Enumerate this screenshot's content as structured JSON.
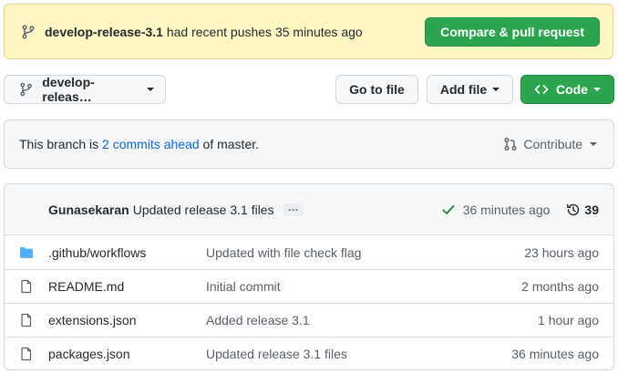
{
  "banner": {
    "branch": "develop-release-3.1",
    "message": " had recent pushes 35 minutes ago",
    "compare_button": "Compare & pull request"
  },
  "toolbar": {
    "branch_select": "develop-releas…",
    "goto_file": "Go to file",
    "add_file": "Add file",
    "code": "Code"
  },
  "ahead_bar": {
    "prefix": "This branch is ",
    "link": "2 commits ahead",
    "suffix": " of master.",
    "contribute": "Contribute"
  },
  "latest_commit": {
    "author": "Gunasekaran",
    "message": "Updated release 3.1 files",
    "ellipsis": "…",
    "time": "36 minutes ago",
    "commit_count": "39"
  },
  "files": [
    {
      "type": "folder",
      "icon": "folder-icon",
      "name": ".github/workflows",
      "message": "Updated with file check flag",
      "age": "23 hours ago"
    },
    {
      "type": "file",
      "icon": "file-icon",
      "name": "README.md",
      "message": "Initial commit",
      "age": "2 months ago"
    },
    {
      "type": "file",
      "icon": "file-icon",
      "name": "extensions.json",
      "message": "Added release 3.1",
      "age": "1 hour ago"
    },
    {
      "type": "file",
      "icon": "file-icon",
      "name": "packages.json",
      "message": "Updated release 3.1 files",
      "age": "36 minutes ago"
    }
  ],
  "colors": {
    "primary_green": "#2da44e",
    "link_blue": "#0969da",
    "banner_yellow": "#fff8c5",
    "folder_blue": "#54aeff"
  }
}
